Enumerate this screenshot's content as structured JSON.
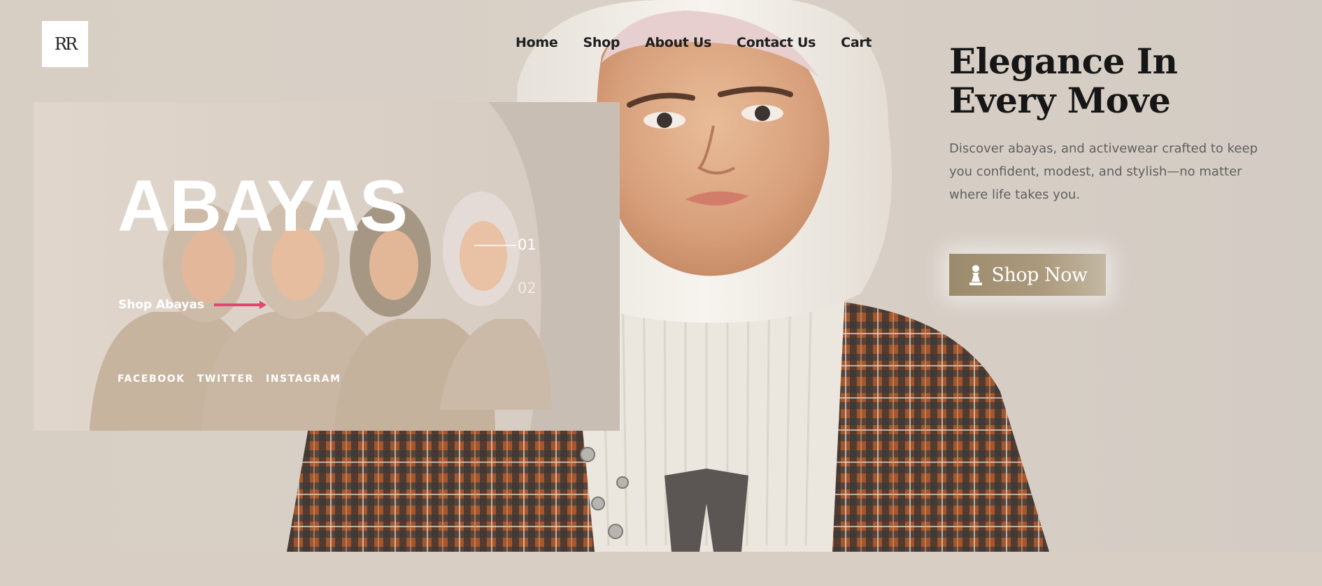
{
  "brand": {
    "logo_text": "RR"
  },
  "nav": {
    "items": [
      {
        "label": "Home"
      },
      {
        "label": "Shop"
      },
      {
        "label": "About Us"
      },
      {
        "label": "Contact Us"
      },
      {
        "label": "Cart"
      }
    ]
  },
  "slider": {
    "title": "ABAYAS",
    "slide_numbers": [
      "01",
      "02"
    ],
    "cta_label": "Shop Abayas",
    "social": [
      "FACEBOOK",
      "TWITTER",
      "INSTAGRAM"
    ]
  },
  "hero": {
    "headline": "Elegance In Every Move",
    "description": "Discover abayas,  and activewear crafted to keep you confident, modest, and stylish—no matter where life takes you.",
    "button_label": "Shop Now",
    "button_icon": "chess-pawn-icon"
  },
  "colors": {
    "background": "#d8d0c6",
    "button": "#a08f72",
    "accent_arrow": "#e0466e"
  }
}
